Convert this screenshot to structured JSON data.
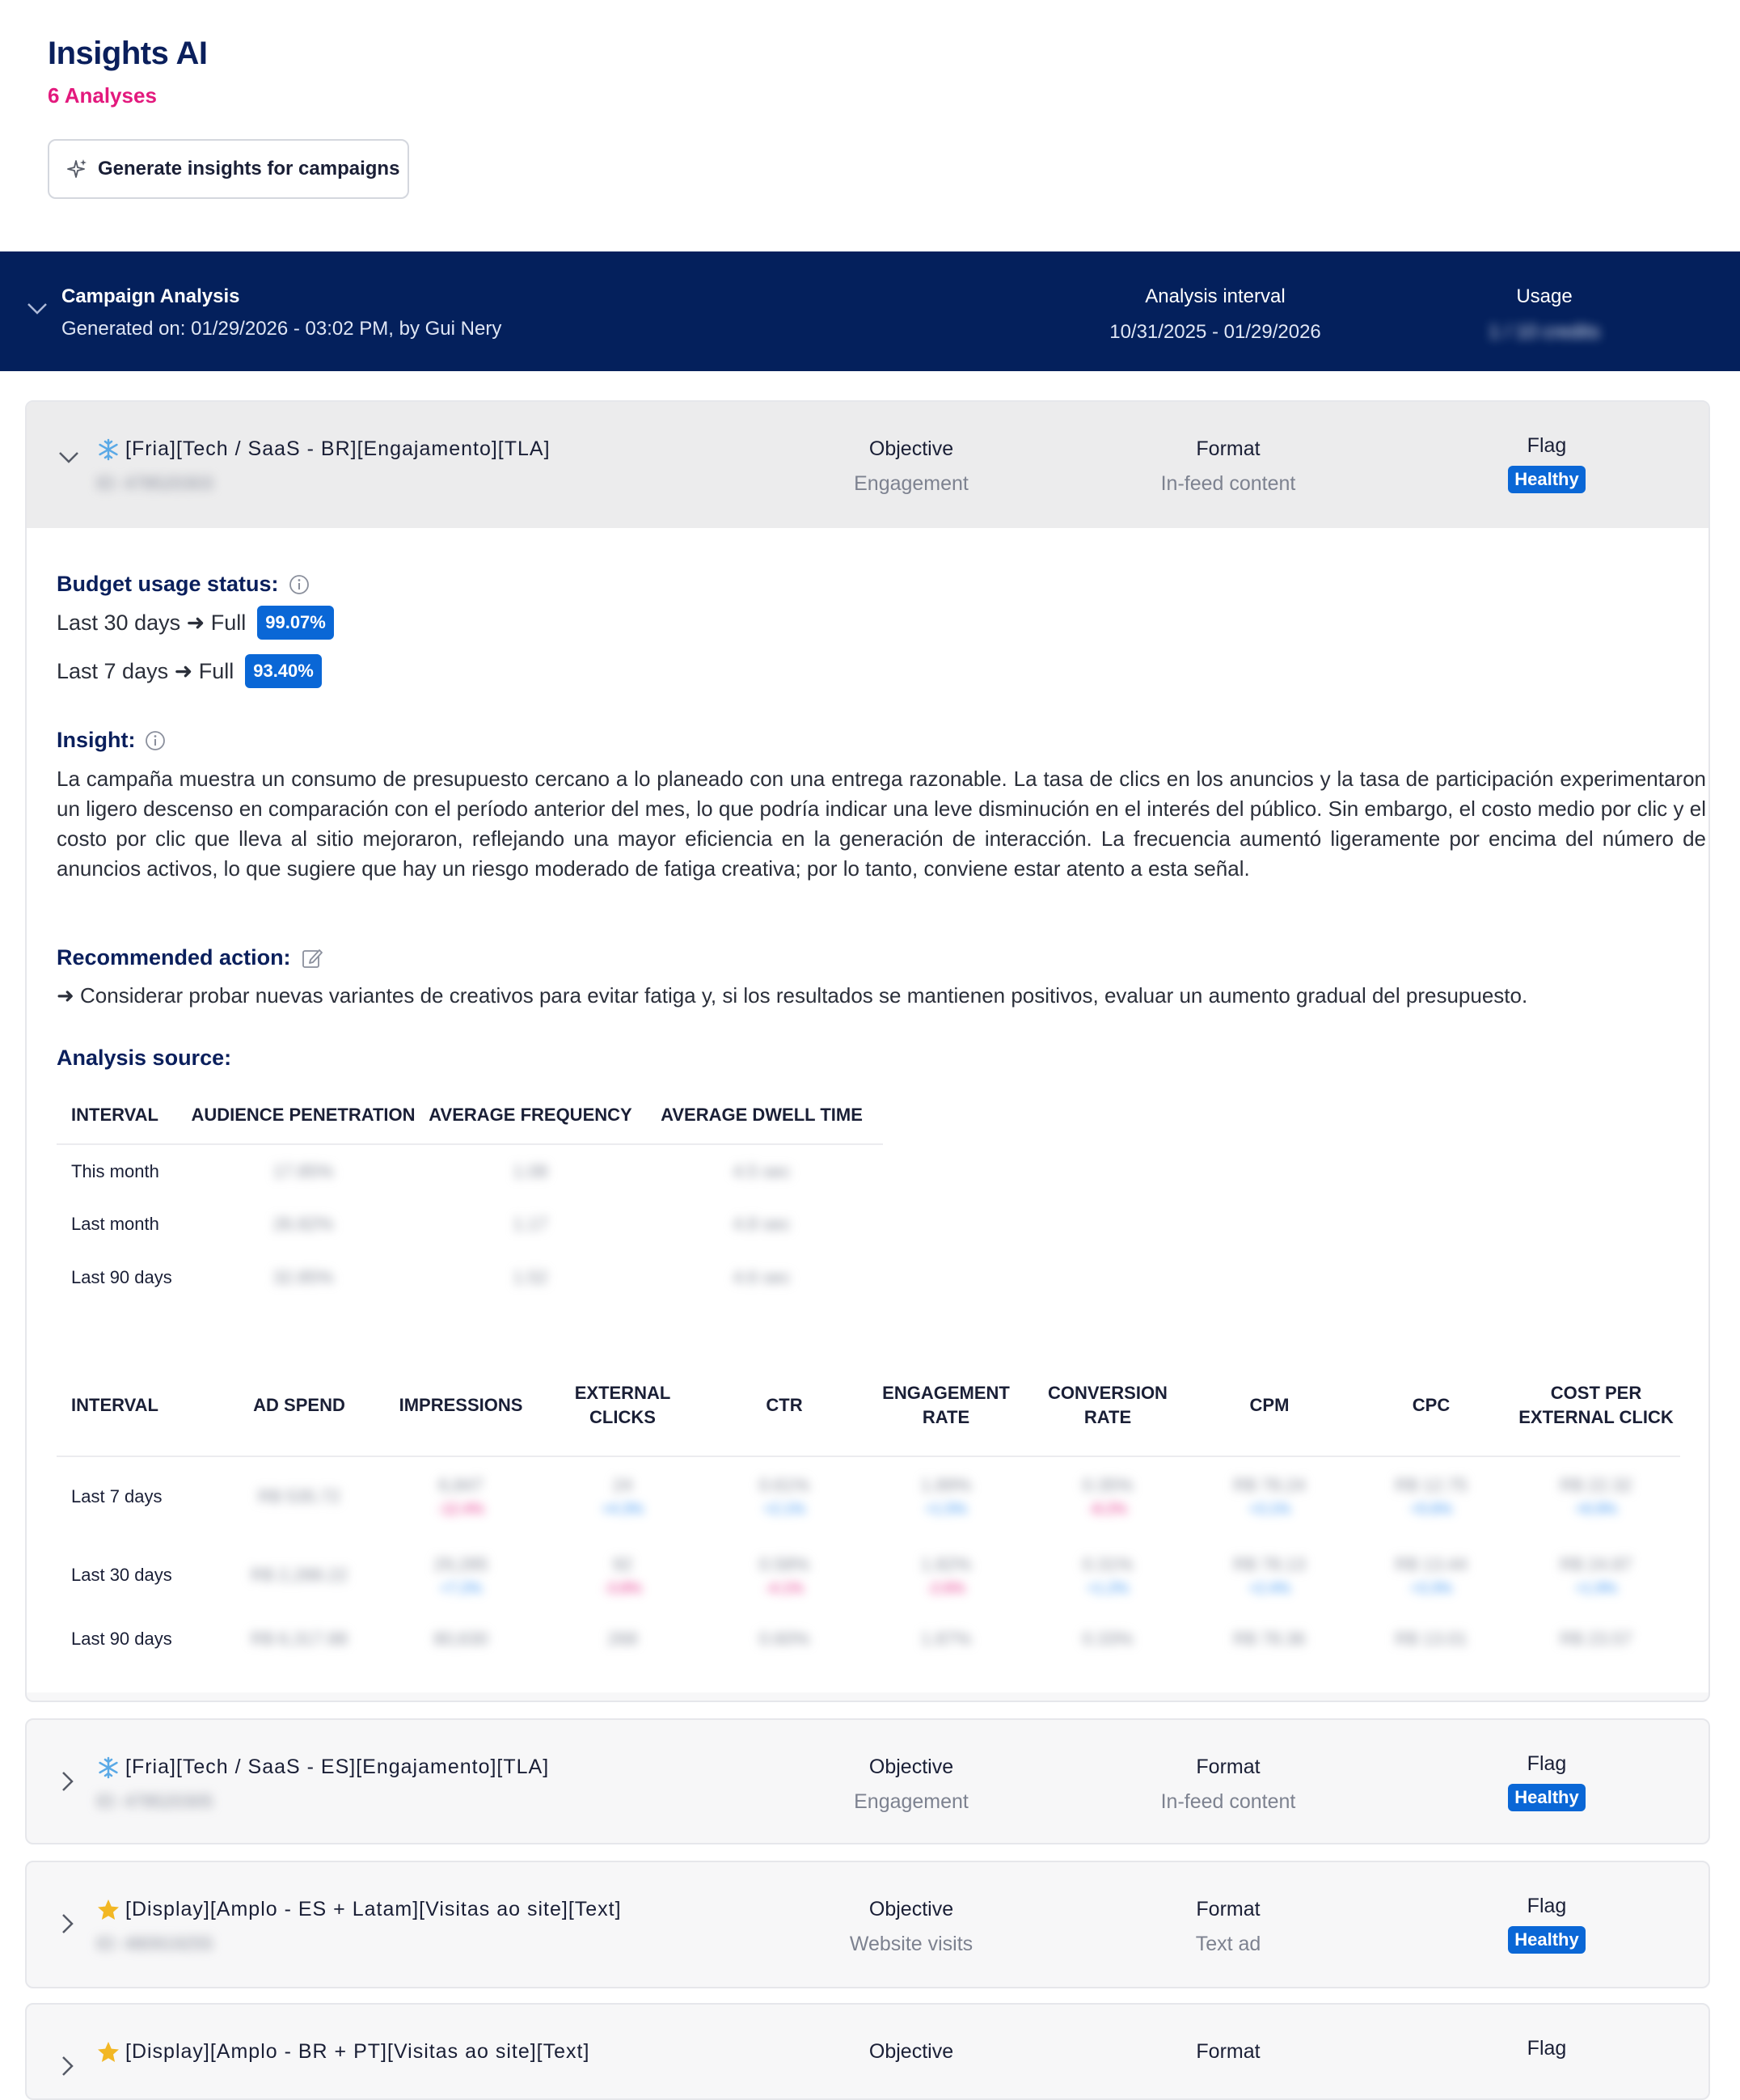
{
  "header": {
    "title": "Insights AI",
    "count": "6 Analyses",
    "generate_button": "Generate insights for campaigns"
  },
  "analysis": {
    "title": "Campaign Analysis",
    "generated": "Generated on: 01/29/2026 - 03:02 PM, by Gui Nery",
    "interval_label": "Analysis interval",
    "interval_value": "10/31/2025 - 01/29/2026",
    "usage_label": "Usage",
    "usage_value": "1 / 10 credits"
  },
  "campaigns": [
    {
      "icon": "snowflake-icon",
      "name": "[Fria][Tech / SaaS - BR][Engajamento][TLA]",
      "id": "ID: 478520303",
      "objective_label": "Objective",
      "objective": "Engagement",
      "format_label": "Format",
      "format": "In-feed content",
      "flag_label": "Flag",
      "flag": "Healthy",
      "expanded": true
    },
    {
      "icon": "snowflake-icon",
      "name": "[Fria][Tech / SaaS - ES][Engajamento][TLA]",
      "id": "ID: 478520305",
      "objective_label": "Objective",
      "objective": "Engagement",
      "format_label": "Format",
      "format": "In-feed content",
      "flag_label": "Flag",
      "flag": "Healthy"
    },
    {
      "icon": "star-icon",
      "name": "[Display][Amplo - ES + Latam][Visitas ao site][Text]",
      "id": "ID: 480919255",
      "objective_label": "Objective",
      "objective": "Website visits",
      "format_label": "Format",
      "format": "Text ad",
      "flag_label": "Flag",
      "flag": "Healthy"
    },
    {
      "icon": "star-icon",
      "name": "[Display][Amplo - BR + PT][Visitas ao site][Text]",
      "objective_label": "Objective",
      "format_label": "Format",
      "flag_label": "Flag"
    }
  ],
  "details": {
    "budget_title": "Budget usage status:",
    "budget_30": "Last 30 days ➜ Full",
    "budget_30_pct": "99.07%",
    "budget_7": "Last 7 days ➜ Full",
    "budget_7_pct": "93.40%",
    "insight_title": "Insight:",
    "insight_text": "La campaña muestra un consumo de presupuesto cercano a lo planeado con una entrega razonable. La tasa de clics en los anuncios y la tasa de participación experimentaron un ligero descenso en comparación con el período anterior del mes, lo que podría indicar una leve disminución en el interés del público. Sin embargo, el costo medio por clic y el costo por clic que lleva al sitio mejoraron, reflejando una mayor eficiencia en la generación de interacción. La frecuencia aumentó ligeramente por encima del número de anuncios activos, lo que sugiere que hay un riesgo moderado de fatiga creativa; por lo tanto, conviene estar atento a esta señal.",
    "action_title": "Recommended action:",
    "action_text": "➜ Considerar probar nuevas variantes de creativos para evitar fatiga y, si los resultados se mantienen positivos, evaluar un aumento gradual del presupuesto.",
    "source_title": "Analysis source:"
  },
  "table1": {
    "headers": [
      "INTERVAL",
      "AUDIENCE PENETRATION",
      "AVERAGE FREQUENCY",
      "AVERAGE DWELL TIME"
    ],
    "rows": [
      [
        "This month",
        "17.85%",
        "1.08",
        "4.5 sec"
      ],
      [
        "Last month",
        "26.82%",
        "1.17",
        "4.8 sec"
      ],
      [
        "Last 90 days",
        "32.85%",
        "1.52",
        "4.6 sec"
      ]
    ]
  },
  "table2": {
    "headers": [
      "INTERVAL",
      "AD SPEND",
      "IMPRESSIONS",
      "EXTERNAL CLICKS",
      "CTR",
      "ENGAGEMENT RATE",
      "CONVERSION RATE",
      "CPM",
      "CPC",
      "COST PER EXTERNAL CLICK"
    ],
    "rows": [
      {
        "label": "Last 7 days",
        "cells": [
          {
            "v": "R$ 535.72",
            "d": ""
          },
          {
            "v": "6,847",
            "d": "-12.4%",
            "c": "pink"
          },
          {
            "v": "24",
            "d": "+4.3%",
            "c": "blue"
          },
          {
            "v": "0.61%",
            "d": "+2.1%",
            "c": "blue"
          },
          {
            "v": "1.89%",
            "d": "+1.5%",
            "c": "blue"
          },
          {
            "v": "0.35%",
            "d": "-8.2%",
            "c": "pink"
          },
          {
            "v": "R$ 78.24",
            "d": "+3.1%",
            "c": "blue"
          },
          {
            "v": "R$ 12.75",
            "d": "+5.6%",
            "c": "blue"
          },
          {
            "v": "R$ 22.32",
            "d": "+6.9%",
            "c": "blue"
          }
        ]
      },
      {
        "label": "Last 30 days",
        "cells": [
          {
            "v": "R$ 2,288.22",
            "d": ""
          },
          {
            "v": "29,285",
            "d": "+7.2%",
            "c": "blue"
          },
          {
            "v": "92",
            "d": "-3.8%",
            "c": "pink"
          },
          {
            "v": "0.58%",
            "d": "-4.1%",
            "c": "pink"
          },
          {
            "v": "1.82%",
            "d": "-2.6%",
            "c": "pink"
          },
          {
            "v": "0.31%",
            "d": "+1.2%",
            "c": "blue"
          },
          {
            "v": "R$ 78.13",
            "d": "+2.4%",
            "c": "blue"
          },
          {
            "v": "R$ 13.44",
            "d": "+3.3%",
            "c": "blue"
          },
          {
            "v": "R$ 24.87",
            "d": "+1.9%",
            "c": "blue"
          }
        ]
      },
      {
        "label": "Last 90 days",
        "cells": [
          {
            "v": "R$ 6,317.88"
          },
          {
            "v": "80,630"
          },
          {
            "v": "268"
          },
          {
            "v": "0.60%"
          },
          {
            "v": "1.87%"
          },
          {
            "v": "0.33%"
          },
          {
            "v": "R$ 78.36"
          },
          {
            "v": "R$ 13.01"
          },
          {
            "v": "R$ 23.57"
          }
        ]
      }
    ]
  },
  "colors": {
    "navy": "#04205c",
    "pink": "#e3197d",
    "badge_blue": "#0a67d6"
  }
}
